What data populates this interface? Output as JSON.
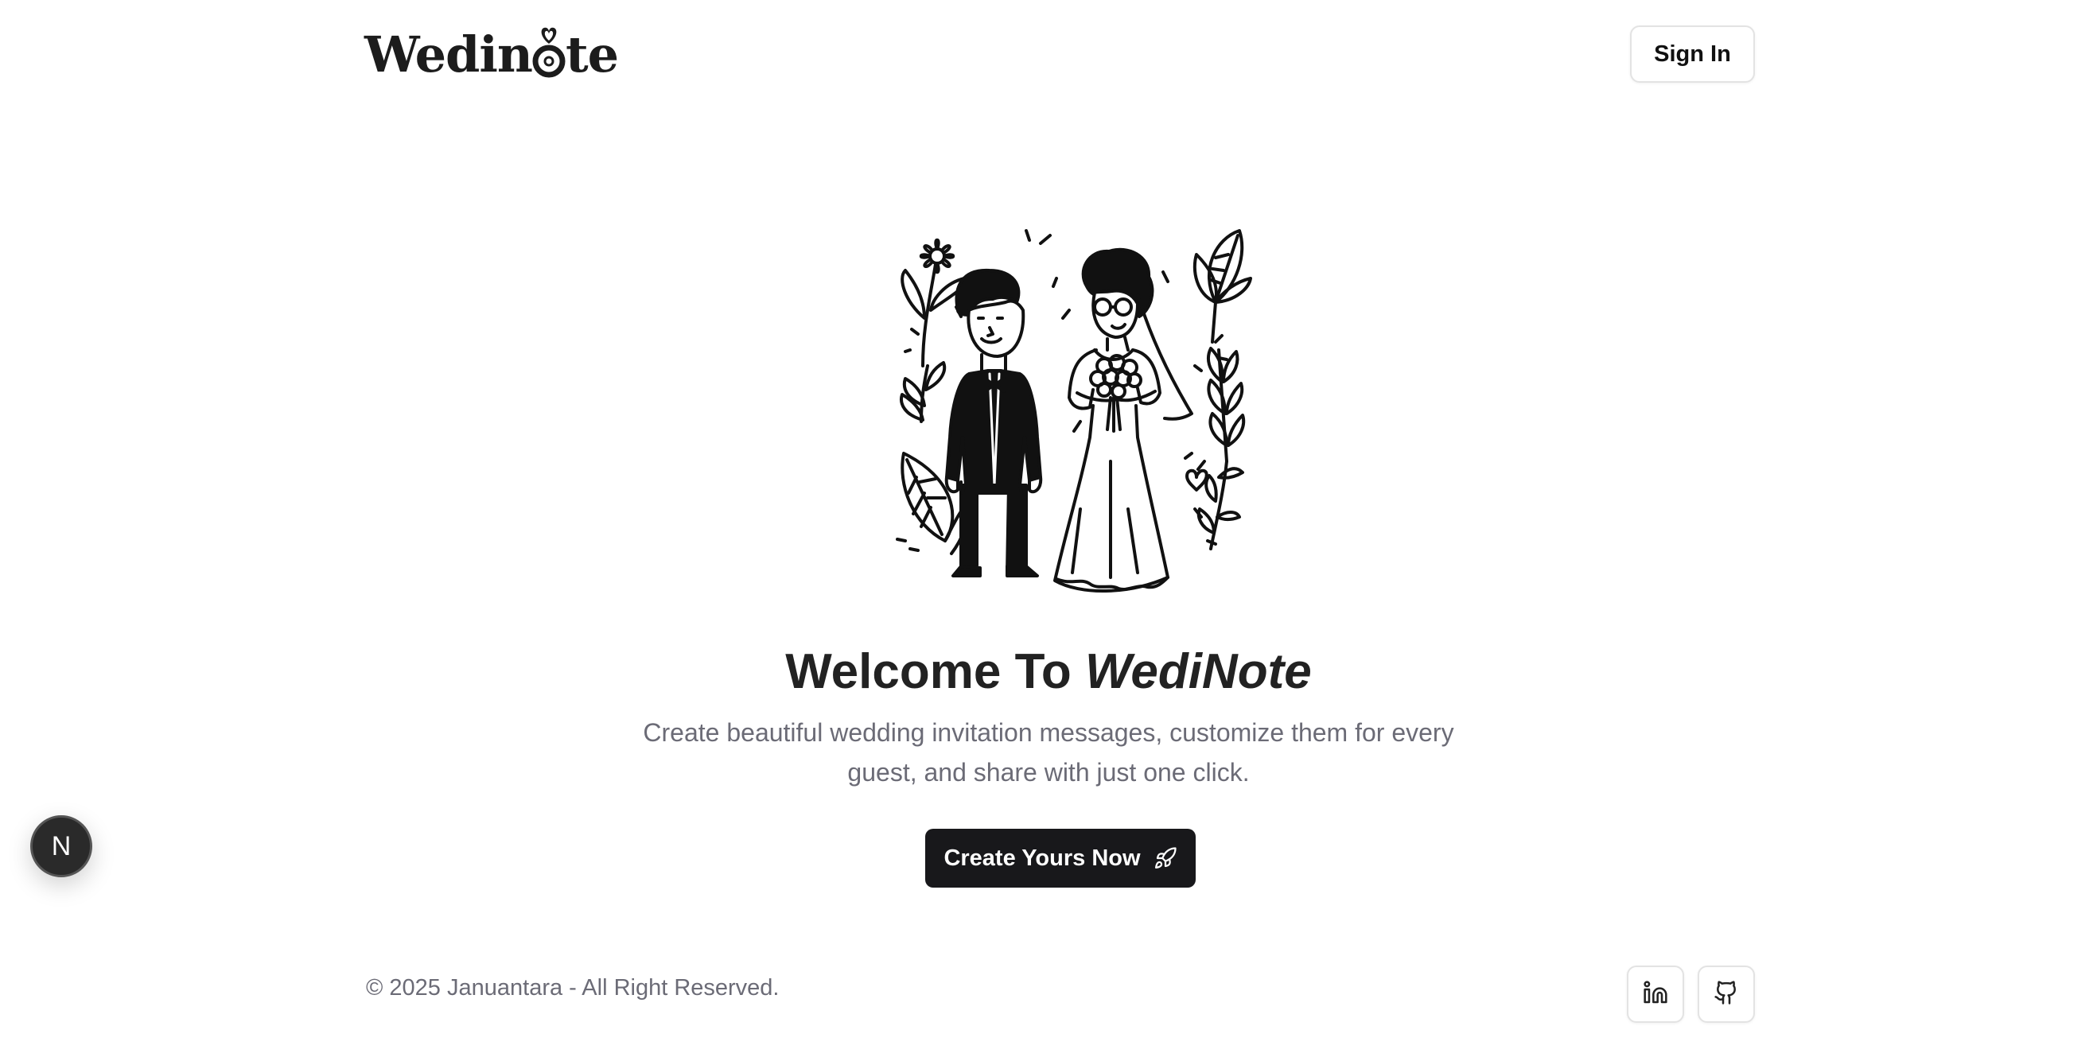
{
  "header": {
    "logo_prefix": "Wedin",
    "logo_suffix": "te",
    "logo_text": "Wedinote",
    "sign_in_label": "Sign In"
  },
  "hero": {
    "title_plain": "Welcome To ",
    "title_emphasis": "WediNote",
    "subtitle": "Create beautiful wedding invitation messages, customize them for every guest, and share with just one click.",
    "cta_label": "Create Yours Now",
    "cta_icon": "rocket-icon",
    "illustration": "bride-and-groom-illustration"
  },
  "dev_badge": {
    "label": "N",
    "icon": "nextjs-icon"
  },
  "footer": {
    "copyright": "© 2025 Januantara - All Right Reserved.",
    "social": [
      {
        "name": "linkedin",
        "icon": "linkedin-icon"
      },
      {
        "name": "github",
        "icon": "github-icon"
      }
    ]
  },
  "colors": {
    "background": "#ffffff",
    "text_primary": "#222222",
    "text_muted": "#6b6b76",
    "button_dark": "#18181b",
    "border": "#e3e3e3"
  }
}
